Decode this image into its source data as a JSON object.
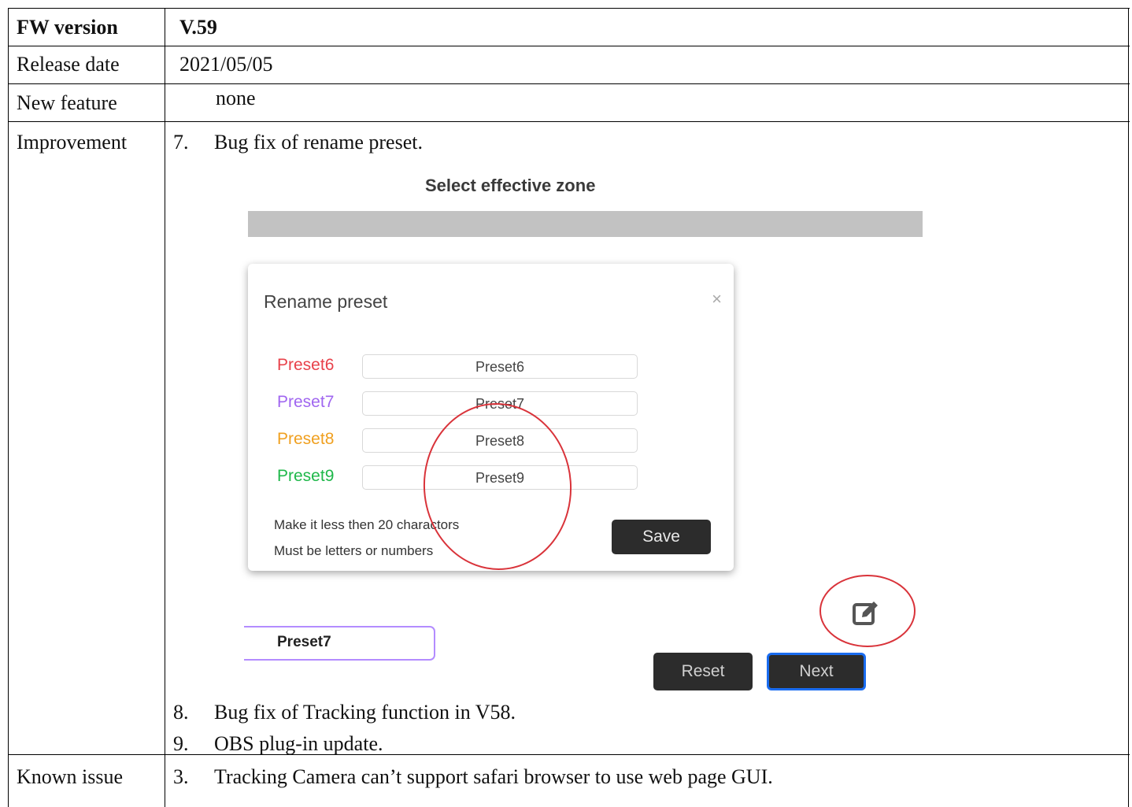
{
  "rows": {
    "fw_version": {
      "label": "FW version",
      "value": "V.59"
    },
    "release_date": {
      "label": "Release date",
      "value": "2021/05/05"
    },
    "new_feature": {
      "label": "New feature",
      "value": "none"
    },
    "improvement": {
      "label": "Improvement",
      "items": [
        {
          "num": "7.",
          "text": "Bug fix of rename preset."
        },
        {
          "num": "8.",
          "text": "Bug fix of Tracking function in V58."
        },
        {
          "num": "9.",
          "text": "OBS plug-in update."
        }
      ]
    },
    "known_issue": {
      "label": "Known issue",
      "items": [
        {
          "num": "3.",
          "text": "Tracking Camera can’t support safari browser to use web page GUI."
        }
      ]
    }
  },
  "screenshot": {
    "title": "Select effective zone",
    "modal": {
      "title": "Rename preset",
      "close": "×",
      "presets": [
        {
          "label": "Preset6",
          "value": "Preset6",
          "color": "#e8414a"
        },
        {
          "label": "Preset7",
          "value": "Preset7",
          "color": "#a066f0"
        },
        {
          "label": "Preset8",
          "value": "Preset8",
          "color": "#f0a020"
        },
        {
          "label": "Preset9",
          "value": "Preset9",
          "color": "#1fb84a"
        }
      ],
      "hint1": "Make it less then 20 charactors",
      "hint2": "Must be letters or numbers",
      "save": "Save"
    },
    "preset_field": "Preset7",
    "reset": "Reset",
    "next": "Next",
    "edit_icon": "edit-icon",
    "annotation_color": "#d9333a"
  }
}
